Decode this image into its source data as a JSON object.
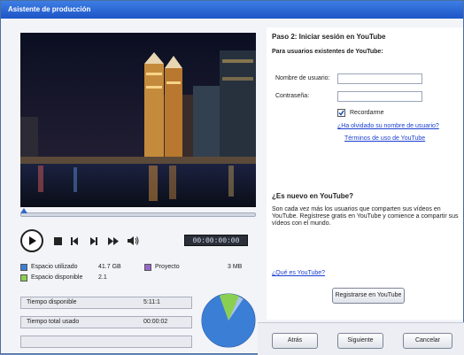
{
  "window": {
    "title": "Asistente de producción"
  },
  "player": {
    "timecode": "00:00:00:00",
    "progress": 0
  },
  "disk": {
    "used_label": "Espacio utilizado",
    "used_value": "41.7 GB",
    "free_label": "Espacio disponible",
    "free_value": "2.1",
    "project_label": "Proyecto",
    "project_value": "3 MB",
    "fields": [
      {
        "label": "Tiempo disponible",
        "value": "5:11:1"
      },
      {
        "label": "Tiempo total usado",
        "value": "00:00:02"
      },
      {
        "label": "",
        "value": ""
      }
    ],
    "pie": {
      "used_fraction": 0.85,
      "project_fraction": 0.12,
      "used_color": "#3b7ed6",
      "project_color": "#8bcf52",
      "free_color": "#a7c2ec"
    }
  },
  "youtube": {
    "heading": "Paso 2: Iniciar sesión en YouTube",
    "subheading": "Para usuarios existentes de YouTube:",
    "username_label": "Nombre de usuario:",
    "password_label": "Contraseña:",
    "remember_label": "Recordarme",
    "forgot_link": "¿Ha olvidado su nombre de usuario?",
    "terms_link": "Términos de uso de YouTube",
    "new_heading": "¿Es nuevo en YouTube?",
    "new_text": "Son cada vez más los usuarios que comparten sus vídeos en YouTube. Regístrese gratis en YouTube y comience a compartir sus vídeos con el mundo.",
    "what_link": "¿Qué es YouTube?",
    "register_button": "Registrarse en YouTube"
  },
  "nav": {
    "back": "Atrás",
    "next": "Siguiente",
    "cancel": "Cancelar"
  }
}
